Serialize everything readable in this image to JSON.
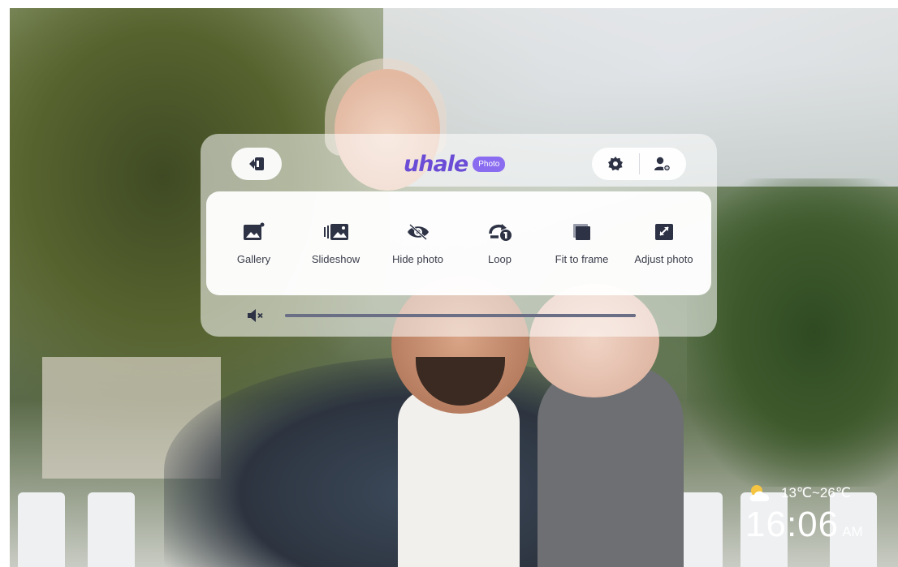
{
  "header": {
    "exit_icon": "exit-icon",
    "logo_text": "uhale",
    "logo_badge": "Photo",
    "settings_icon": "gear-icon",
    "account_icon": "add-user-icon"
  },
  "menu": {
    "items": [
      {
        "label": "Gallery",
        "icon": "gallery-icon"
      },
      {
        "label": "Slideshow",
        "icon": "slideshow-icon"
      },
      {
        "label": "Hide photo",
        "icon": "hide-photo-icon"
      },
      {
        "label": "Loop",
        "icon": "loop-icon"
      },
      {
        "label": "Fit to frame",
        "icon": "fit-to-frame-icon"
      },
      {
        "label": "Adjust photo",
        "icon": "adjust-photo-icon"
      }
    ]
  },
  "volume": {
    "icon": "mute-icon",
    "level": 1.0
  },
  "weather": {
    "icon": "partly-cloudy-icon",
    "range": "13℃~26℃"
  },
  "clock": {
    "time": "16:06",
    "ampm": "AM"
  },
  "colors": {
    "accent": "#6b4cd6",
    "icon": "#2d3245"
  }
}
